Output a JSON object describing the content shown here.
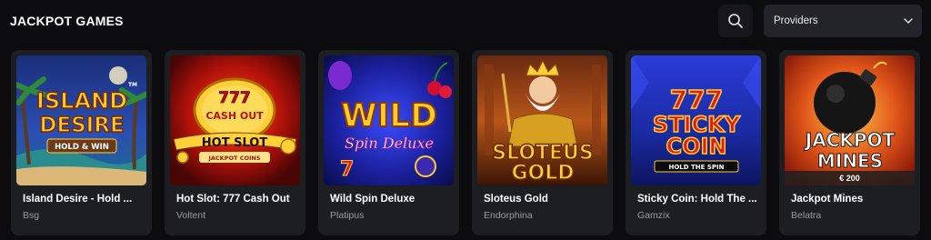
{
  "section": {
    "title": "JACKPOT GAMES"
  },
  "header": {
    "search_icon": "search-icon",
    "providers_label": "Providers",
    "providers_icon": "chevron-down-icon"
  },
  "games": [
    {
      "title": "Island Desire - Hold ...",
      "provider": "Bsg",
      "art": [
        "ISLAND",
        "DESIRE",
        "HOLD & WIN",
        "TM"
      ]
    },
    {
      "title": "Hot Slot: 777 Cash Out",
      "provider": "Voltent",
      "art": [
        "777",
        "CASH OUT",
        "HOT SLOT",
        "JACKPOT COINS"
      ]
    },
    {
      "title": "Wild Spin Deluxe",
      "provider": "Platipus",
      "art": [
        "WILD",
        "Spin Deluxe"
      ]
    },
    {
      "title": "Sloteus Gold",
      "provider": "Endorphina",
      "art": [
        "SLOTEUS",
        "GOLD"
      ]
    },
    {
      "title": "Sticky Coin: Hold The ...",
      "provider": "Gamzix",
      "art": [
        "777",
        "STICKY",
        "COIN",
        "HOLD THE SPIN"
      ]
    },
    {
      "title": "Jackpot Mines",
      "provider": "Belatra",
      "art": [
        "JACKPOT",
        "MINES"
      ],
      "bet": "€ 200"
    }
  ],
  "colors": {
    "background": "#0c0c0e",
    "card": "#1d1e22",
    "provider_text": "#9a9ba3",
    "dropdown": "#23242a"
  }
}
